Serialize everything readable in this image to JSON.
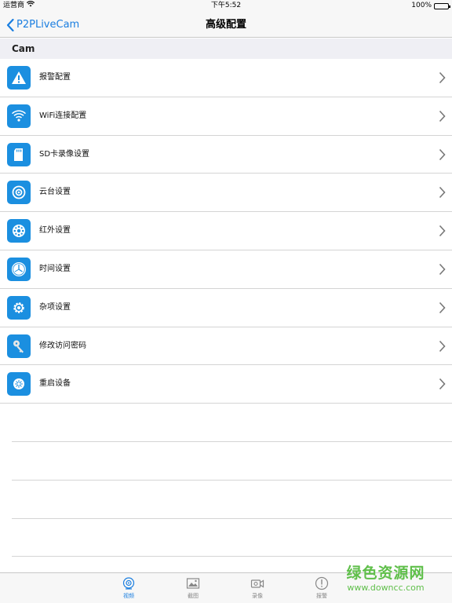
{
  "status_bar": {
    "carrier": "运营商",
    "time": "下午5:52",
    "battery": "100%"
  },
  "nav": {
    "back_label": "P2PLiveCam",
    "title": "高级配置"
  },
  "section": {
    "title": "Cam"
  },
  "rows": [
    {
      "label": "报警配置",
      "icon": "warning-icon"
    },
    {
      "label": "WiFi连接配置",
      "icon": "wifi-icon"
    },
    {
      "label": "SD卡录像设置",
      "icon": "sd-card-icon"
    },
    {
      "label": "云台设置",
      "icon": "ptz-icon"
    },
    {
      "label": "红外设置",
      "icon": "infrared-icon"
    },
    {
      "label": "时间设置",
      "icon": "clock-icon"
    },
    {
      "label": "杂项设置",
      "icon": "gear-icon"
    },
    {
      "label": "修改访问密码",
      "icon": "key-icon"
    },
    {
      "label": "重启设备",
      "icon": "restart-icon"
    }
  ],
  "tabs": [
    {
      "label": "视频",
      "icon": "video-icon",
      "active": true
    },
    {
      "label": "截图",
      "icon": "picture-icon",
      "active": false
    },
    {
      "label": "录像",
      "icon": "record-icon",
      "active": false
    },
    {
      "label": "报警",
      "icon": "alarm-icon",
      "active": false
    }
  ],
  "watermark": {
    "title": "绿色资源网",
    "url": "www.downcc.com"
  },
  "colors": {
    "accent": "#1a7ee0",
    "icon_bg": "#1b8fe0",
    "watermark": "#5fbf4a"
  }
}
